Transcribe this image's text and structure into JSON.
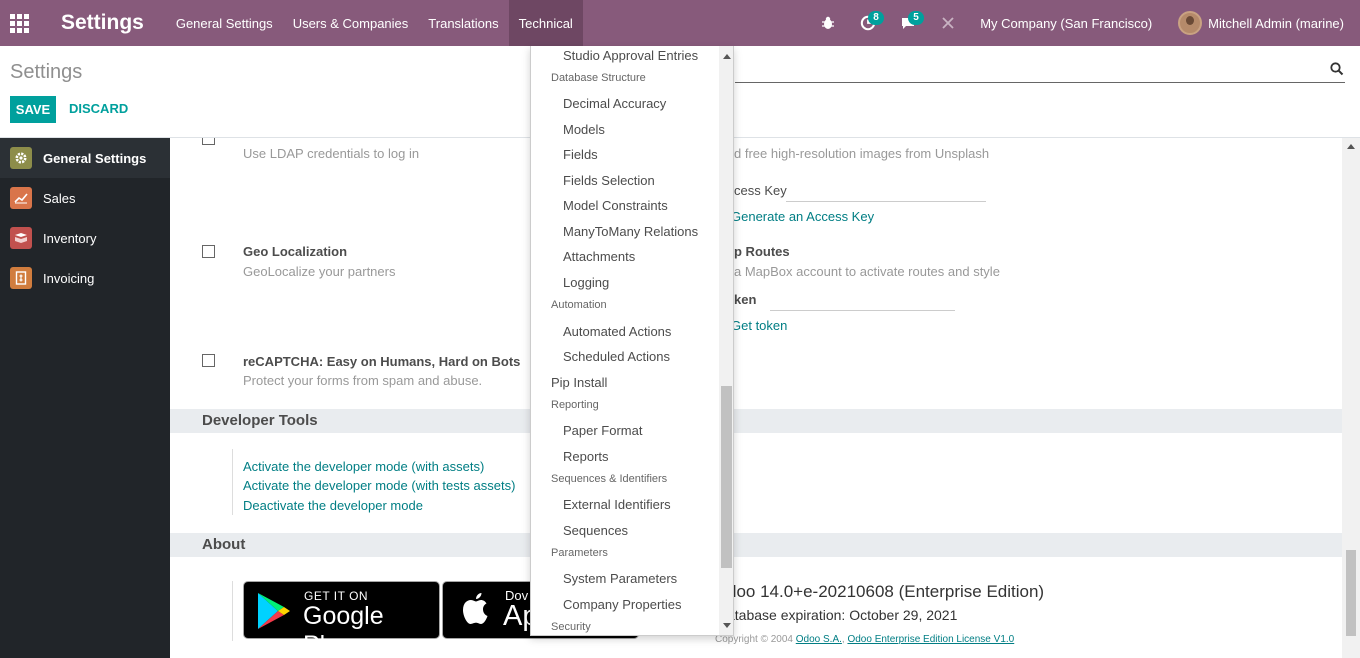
{
  "navbar": {
    "brand": "Settings",
    "menus": [
      "General Settings",
      "Users & Companies",
      "Translations",
      "Technical"
    ],
    "activity_count": "8",
    "messages_count": "5",
    "company": "My Company (San Francisco)",
    "user": "Mitchell Admin (marine)"
  },
  "control_panel": {
    "title": "Settings",
    "save_label": "SAVE",
    "discard_label": "DISCARD"
  },
  "sidebar": {
    "items": [
      {
        "label": "General Settings",
        "icon": "gear-icon",
        "color": "#8d8d4a"
      },
      {
        "label": "Sales",
        "icon": "chart-icon",
        "color": "#d9754a"
      },
      {
        "label": "Inventory",
        "icon": "box-icon",
        "color": "#c1514e"
      },
      {
        "label": "Invoicing",
        "icon": "invoice-icon",
        "color": "#d17d3e"
      }
    ]
  },
  "content": {
    "ldap_desc": "Use LDAP credentials to log in",
    "unsplash_desc": "Find free high-resolution images from Unsplash",
    "unsplash_desc_visible": "d free high-resolution images from Unsplash",
    "access_key_label": "cess Key",
    "generate_key_link": "Generate an Access Key",
    "geo_title": "Geo Localization",
    "geo_desc": "GeoLocalize your partners",
    "map_routes_title": "p Routes",
    "map_routes_desc": "a MapBox account to activate routes and style",
    "token_label": "ken",
    "get_token_link": "Get token",
    "recaptcha_title": "reCAPTCHA: Easy on Humans, Hard on Bots",
    "recaptcha_desc": "Protect your forms from spam and abuse.",
    "dev_tools_header": "Developer Tools",
    "dev_links": [
      "Activate the developer mode (with assets)",
      "Activate the developer mode (with tests assets)",
      "Deactivate the developer mode"
    ],
    "about_header": "About",
    "google_play_small": "GET IT ON",
    "google_play_big": "Google Play",
    "app_store_small": "Dov",
    "app_store_big": "Ap",
    "version": "doo 14.0+e-20210608 (Enterprise Edition)",
    "expiry": "atabase expiration: October 29, 2021",
    "copyright_prefix": "Copyright © 2004",
    "copyright_link1": "Odoo S.A.",
    "copyright_link2": "Odoo Enterprise Edition License V1.0"
  },
  "dropdown": {
    "rows": [
      {
        "type": "item",
        "label": "Studio Approval Entries"
      },
      {
        "type": "header",
        "label": "Database Structure"
      },
      {
        "type": "item",
        "label": "Decimal Accuracy"
      },
      {
        "type": "item",
        "label": "Models"
      },
      {
        "type": "item",
        "label": "Fields"
      },
      {
        "type": "item",
        "label": "Fields Selection"
      },
      {
        "type": "item",
        "label": "Model Constraints"
      },
      {
        "type": "item",
        "label": "ManyToMany Relations"
      },
      {
        "type": "item",
        "label": "Attachments"
      },
      {
        "type": "item",
        "label": "Logging"
      },
      {
        "type": "header",
        "label": "Automation"
      },
      {
        "type": "item",
        "label": "Automated Actions"
      },
      {
        "type": "item",
        "label": "Scheduled Actions"
      },
      {
        "type": "top",
        "label": "Pip Install"
      },
      {
        "type": "header",
        "label": "Reporting"
      },
      {
        "type": "item",
        "label": "Paper Format"
      },
      {
        "type": "item",
        "label": "Reports"
      },
      {
        "type": "header",
        "label": "Sequences & Identifiers"
      },
      {
        "type": "item",
        "label": "External Identifiers"
      },
      {
        "type": "item",
        "label": "Sequences"
      },
      {
        "type": "header",
        "label": "Parameters"
      },
      {
        "type": "item",
        "label": "System Parameters"
      },
      {
        "type": "item",
        "label": "Company Properties"
      },
      {
        "type": "header",
        "label": "Security"
      }
    ]
  }
}
